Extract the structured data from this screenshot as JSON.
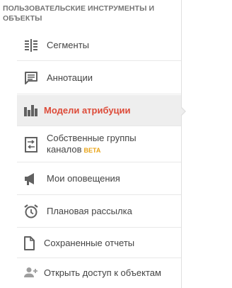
{
  "panel": {
    "heading": "ПОЛЬЗОВАТЕЛЬСКИЕ ИНСТРУМЕНТЫ И ОБЪЕКТЫ",
    "items": [
      {
        "label": "Сегменты",
        "icon": "segments-icon"
      },
      {
        "label": "Аннотации",
        "icon": "annotation-icon"
      },
      {
        "label": "Модели атрибуции",
        "icon": "bar-chart-icon",
        "active": true
      },
      {
        "label": "Собственные группы",
        "label2": "каналов",
        "badge": "BETA",
        "icon": "channel-groups-icon"
      },
      {
        "label": "Мои оповещения",
        "icon": "megaphone-icon"
      },
      {
        "label": "Плановая рассылка",
        "icon": "alarm-clock-icon"
      },
      {
        "label": "Сохраненные отчеты",
        "icon": "document-icon"
      }
    ],
    "share_label": "Открыть доступ к объектам"
  },
  "colors": {
    "active_text": "#dd4b39",
    "beta": "#e8a317",
    "icon": "#616161"
  }
}
